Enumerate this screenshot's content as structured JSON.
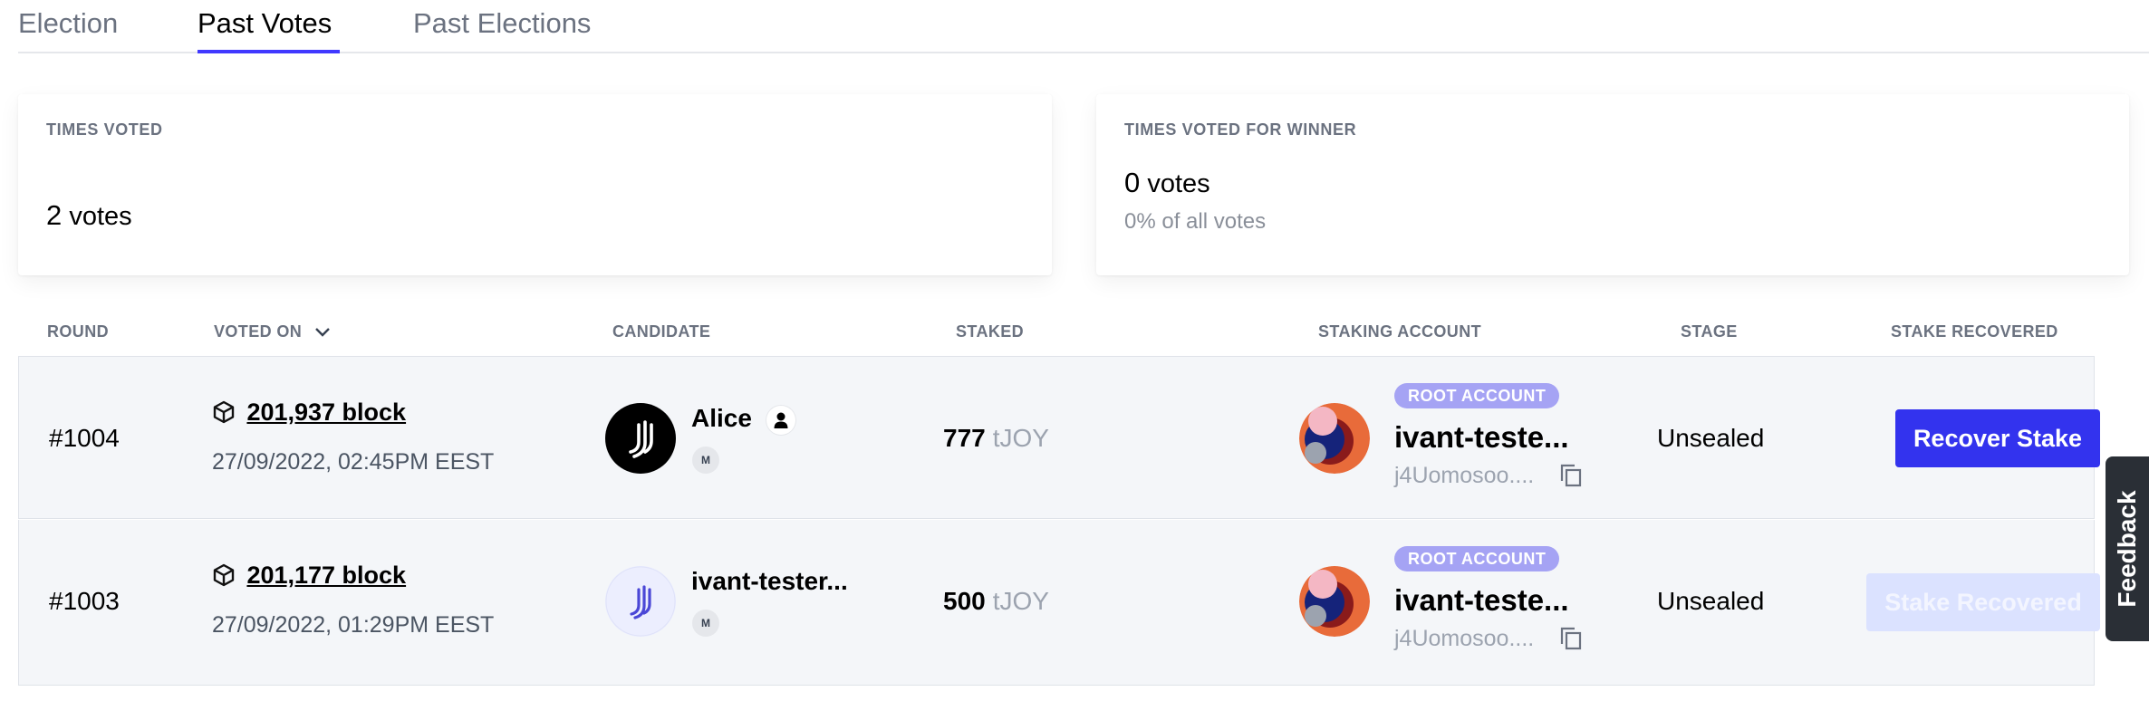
{
  "tabs": [
    {
      "label": "Election"
    },
    {
      "label": "Past Votes"
    },
    {
      "label": "Past Elections"
    }
  ],
  "active_tab": "Past Votes",
  "stats": {
    "times_voted": {
      "label": "TIMES VOTED",
      "value": "2",
      "unit": "votes"
    },
    "times_voted_for_winner": {
      "label": "TIMES VOTED FOR WINNER",
      "value": "0",
      "unit": "votes",
      "sub": "0% of all votes"
    }
  },
  "table": {
    "headers": {
      "round": "ROUND",
      "voted_on": "VOTED ON",
      "candidate": "CANDIDATE",
      "staked": "STAKED",
      "staking_account": "STAKING ACCOUNT",
      "stage": "STAGE",
      "stake_recovered": "STAKE RECOVERED"
    },
    "rows": [
      {
        "round": "#1004",
        "block": "201,937 block",
        "date": "27/09/2022, 02:45PM EEST",
        "candidate": "Alice",
        "member_badge": "M",
        "staked_amount": "777",
        "staked_unit": "tJOY",
        "account_badge": "ROOT ACCOUNT",
        "account_name": "ivant-teste...",
        "account_address": "j4Uomosoo....",
        "stage": "Unsealed",
        "action": "Recover Stake",
        "action_enabled": true
      },
      {
        "round": "#1003",
        "block": "201,177 block",
        "date": "27/09/2022, 01:29PM EEST",
        "candidate": "ivant-tester...",
        "member_badge": "M",
        "staked_amount": "500",
        "staked_unit": "tJOY",
        "account_badge": "ROOT ACCOUNT",
        "account_name": "ivant-teste...",
        "account_address": "j4Uomosoo....",
        "stage": "Unsealed",
        "action": "Stake Recovered",
        "action_enabled": false
      }
    ]
  },
  "feedback_label": "Feedback",
  "colors": {
    "accent": "#3333ee",
    "tab_underline": "#4038ff",
    "root_badge": "#a5a3f4",
    "row_bg": "#f4f6f9",
    "feedback_bg": "#2a2f36"
  },
  "icons": [
    "block-cube-icon",
    "chevron-down-icon",
    "person-icon",
    "copy-icon",
    "joystream-logo-icon",
    "identicon-icon"
  ]
}
